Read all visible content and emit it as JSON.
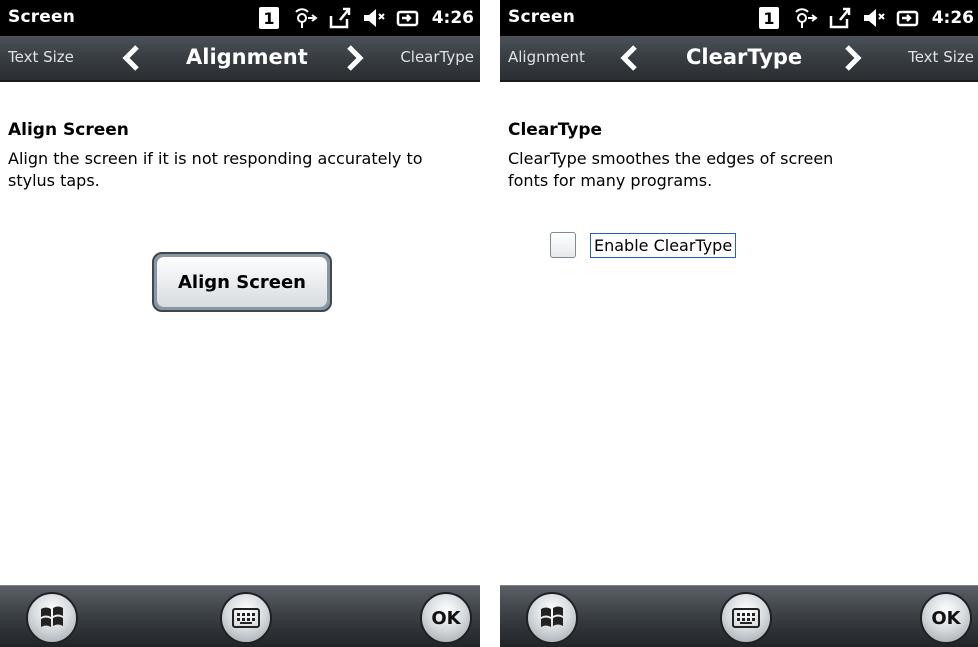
{
  "screens": [
    {
      "status": {
        "app_title": "Screen",
        "sim_slot": "1",
        "time": "4:26"
      },
      "pivot": {
        "prev": "Text Size",
        "current": "Alignment",
        "next": "ClearType"
      },
      "content": {
        "title": "Align Screen",
        "description": "Align the screen if it is not responding accurately to stylus taps.",
        "button_label": "Align Screen"
      },
      "softbar": {
        "ok_label": "OK"
      }
    },
    {
      "status": {
        "app_title": "Screen",
        "sim_slot": "1",
        "time": "4:26"
      },
      "pivot": {
        "prev": "Alignment",
        "current": "ClearType",
        "next": "Text Size"
      },
      "content": {
        "title": "ClearType",
        "description": "ClearType smoothes the edges of screen fonts for many programs.",
        "checkbox_label": "Enable ClearType",
        "checkbox_checked": false
      },
      "softbar": {
        "ok_label": "OK"
      }
    }
  ],
  "icons": {
    "status": [
      "sim-1-icon",
      "connectivity-icon",
      "data-transfer-icon",
      "speaker-muted-icon",
      "battery-charging-icon"
    ],
    "softbar": [
      "windows-start-icon",
      "keyboard-icon",
      "ok-icon"
    ]
  },
  "colors": {
    "status_bg": "#000000",
    "pivot_bg": "#363b40",
    "content_bg": "#ffffff",
    "focus_border": "#2a5fb4"
  }
}
